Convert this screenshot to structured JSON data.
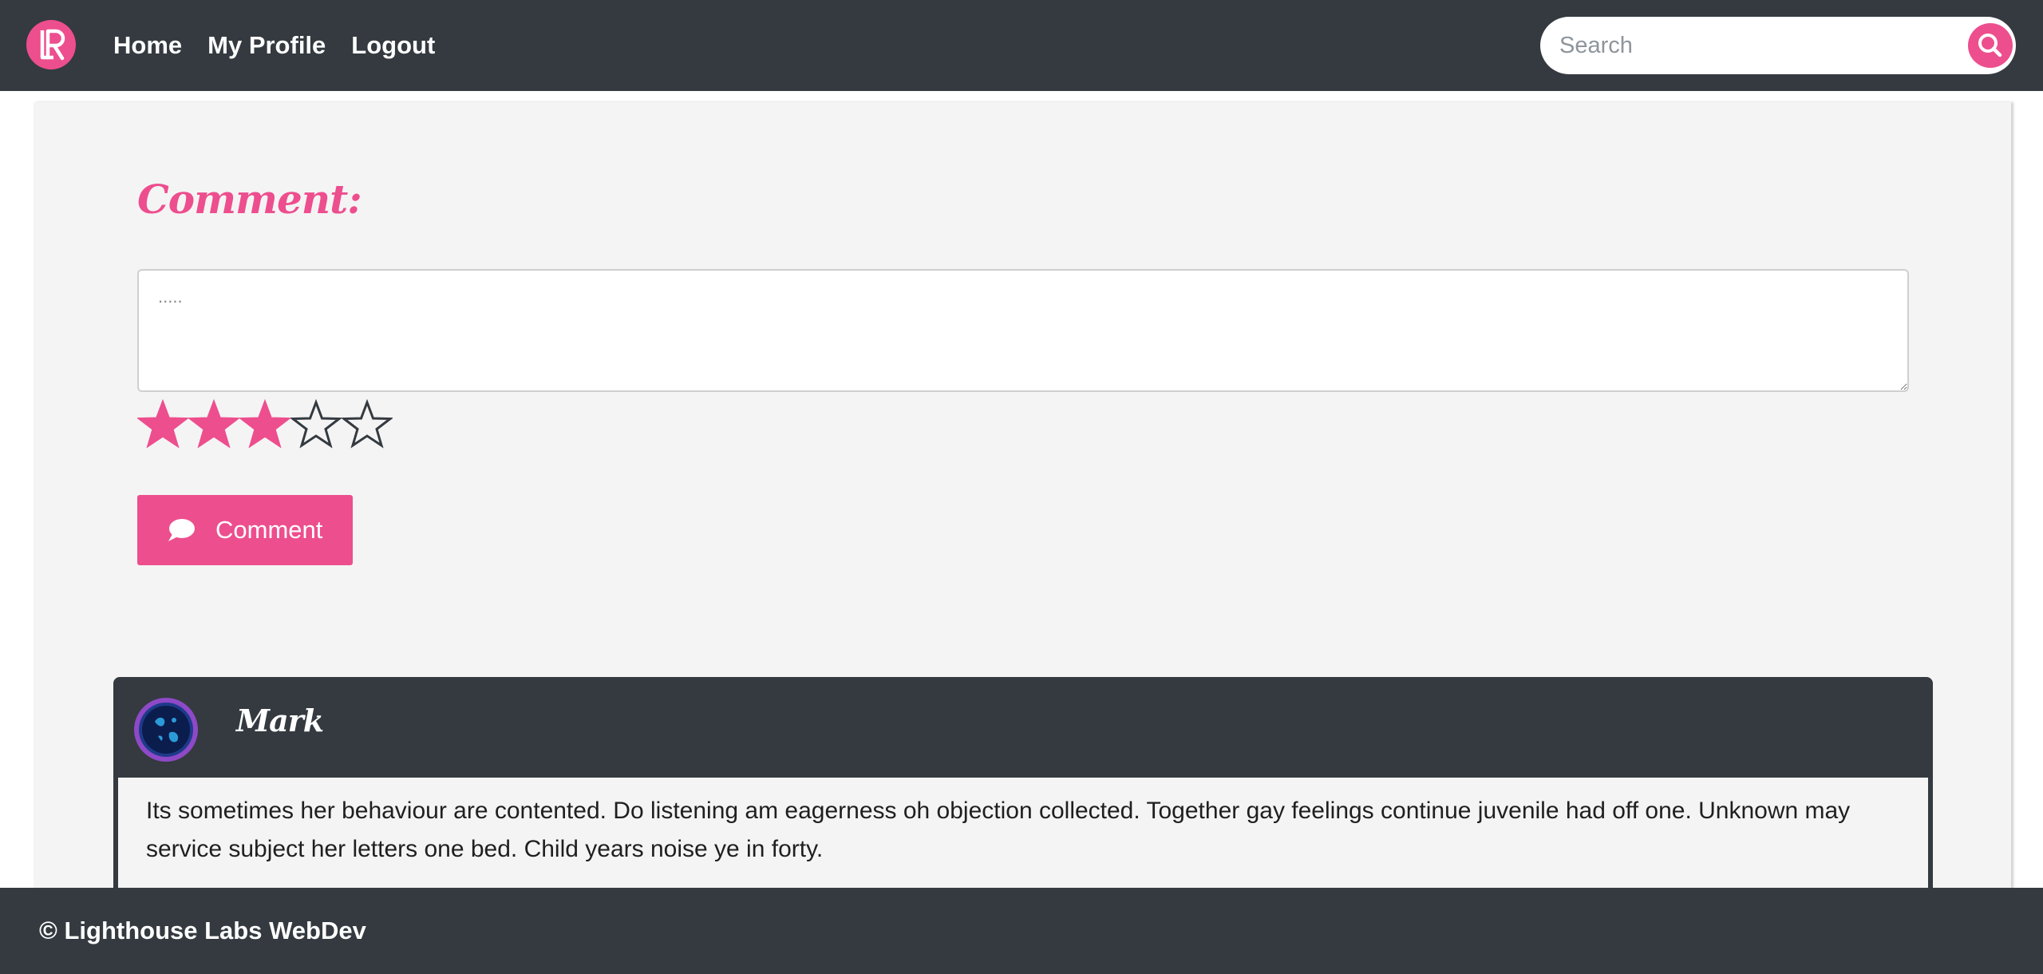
{
  "nav": {
    "logo_icon": "lr-logo-icon",
    "links": [
      {
        "label": "Home"
      },
      {
        "label": "My Profile"
      },
      {
        "label": "Logout"
      }
    ],
    "search": {
      "placeholder": "Search",
      "value": "",
      "icon": "search-icon"
    }
  },
  "form": {
    "heading": "Comment:",
    "textarea_placeholder": ".....",
    "textarea_value": "",
    "rating": {
      "value": 3,
      "max": 5
    },
    "submit_label": "Comment",
    "submit_icon": "chat-bubble-icon"
  },
  "comments": [
    {
      "author": "Mark",
      "text": "Its sometimes her behaviour are contented. Do listening am eagerness oh objection collected. Together gay feelings continue juvenile had off one. Unknown may service subject her letters one bed. Child years noise ye in forty."
    }
  ],
  "footer": {
    "text": "© Lighthouse Labs WebDev"
  },
  "colors": {
    "navbar": "#343a40",
    "accent": "#ed4e8e",
    "panel": "#f4f4f4"
  }
}
